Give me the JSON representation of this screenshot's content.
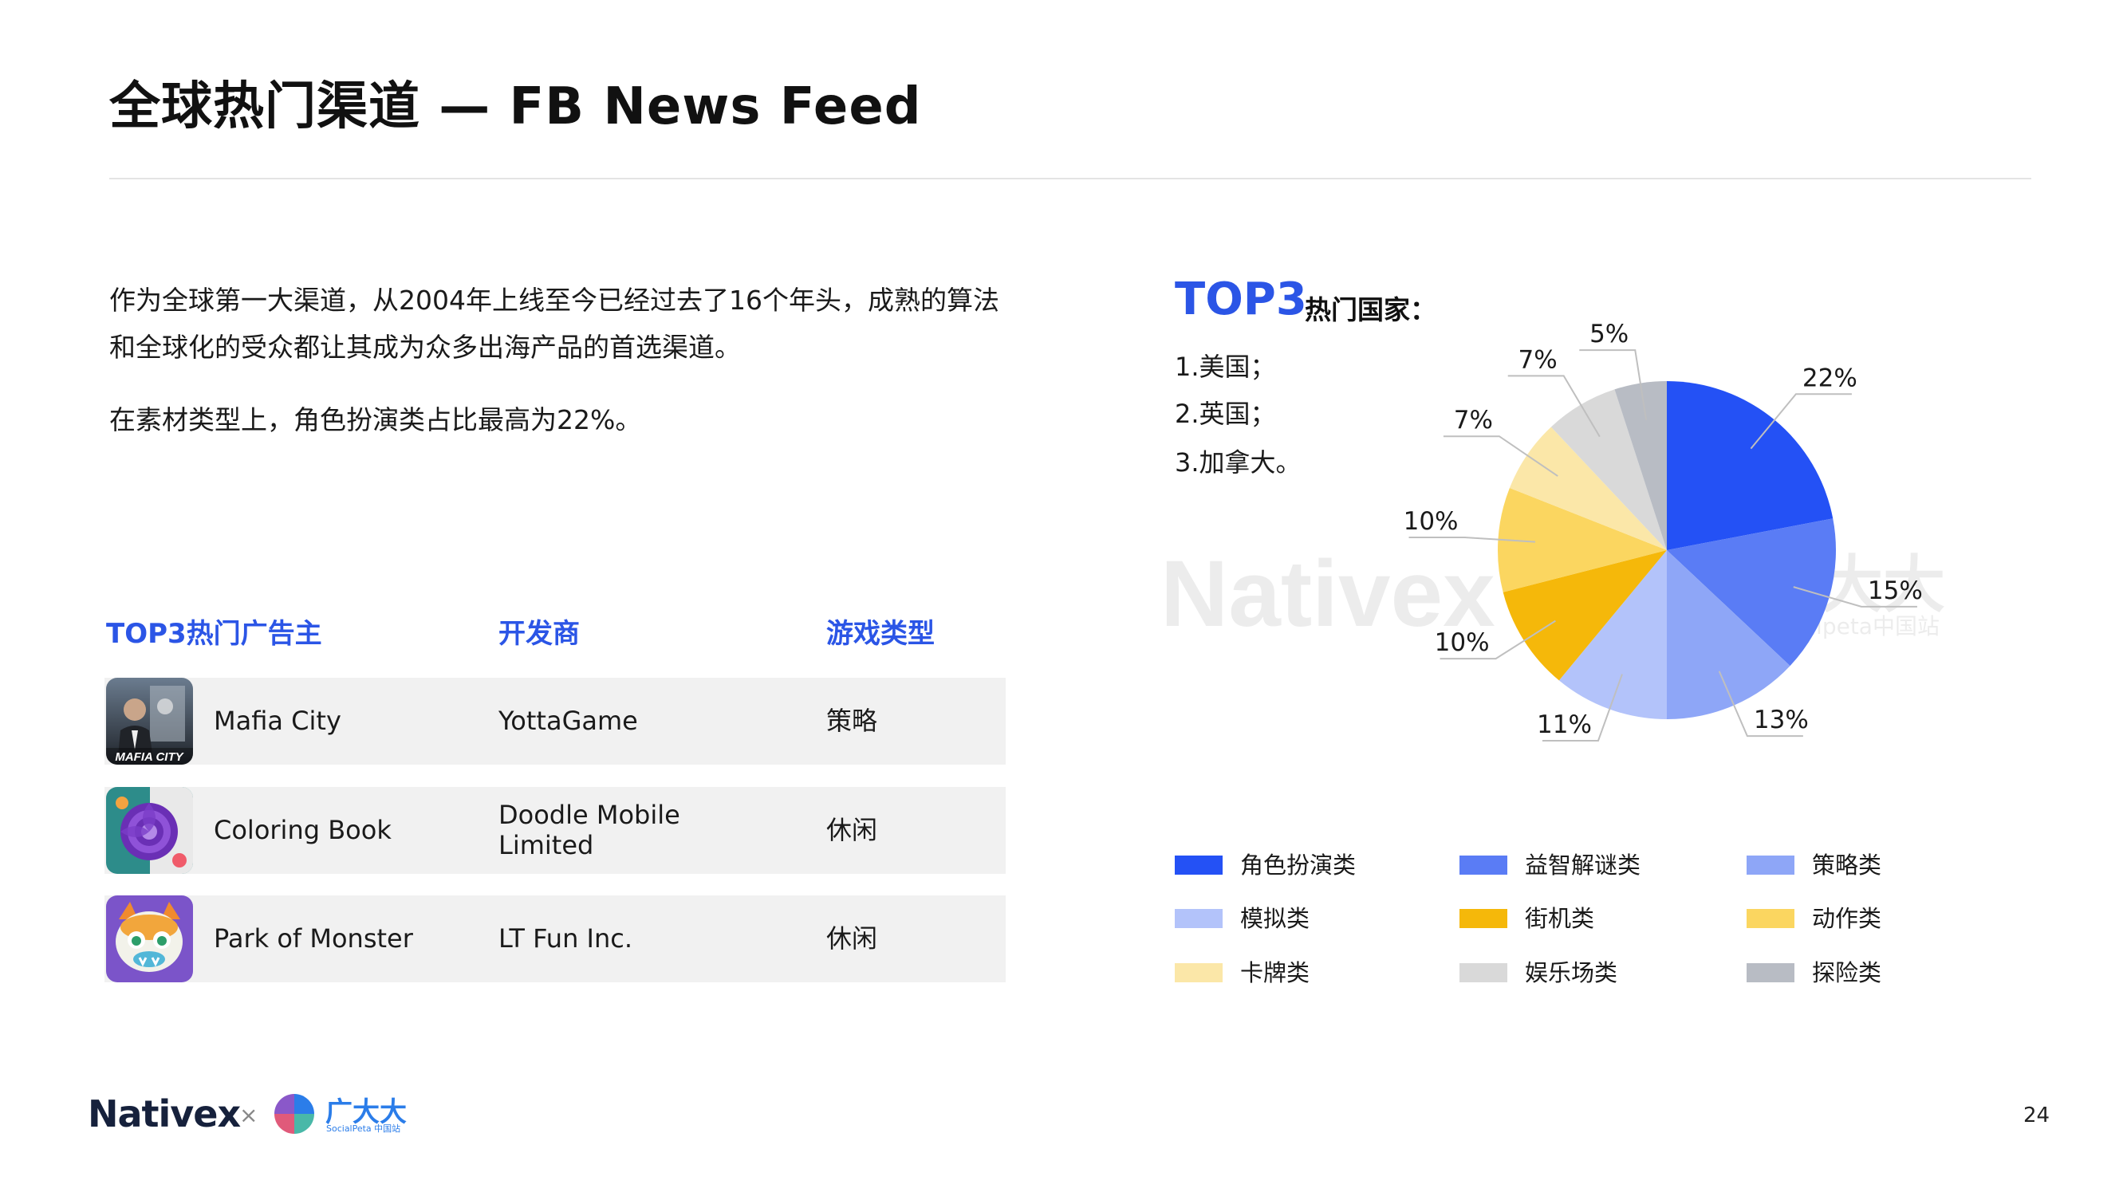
{
  "title": "全球热门渠道 — FB News Feed",
  "intro": {
    "line1": "作为全球第一大渠道，从2004年上线至今已经过去了16个年头，成熟的算法",
    "line2": "和全球化的受众都让其成为众多出海产品的首选渠道。",
    "line3": "在素材类型上，角色扮演类占比最高为22%。"
  },
  "table": {
    "headers": [
      "TOP3热门广告主",
      "开发商",
      "游戏类型"
    ],
    "rows": [
      {
        "app": "Mafia City",
        "icon": "mafia-city-icon",
        "developer_line1": "YottaGame",
        "developer_line2": "",
        "genre": "策略"
      },
      {
        "app": "Coloring Book",
        "icon": "coloring-book-icon",
        "developer_line1": "Doodle Mobile",
        "developer_line2": "Limited",
        "genre": "休闲"
      },
      {
        "app": "Park of Monster",
        "icon": "park-of-monster-icon",
        "developer_line1": "LT Fun Inc.",
        "developer_line2": "",
        "genre": "休闲"
      }
    ]
  },
  "top3": {
    "big": "TOP3",
    "sub": "热门国家：",
    "countries": [
      "1.美国；",
      "2.英国；",
      "3.加拿大。"
    ]
  },
  "watermark": {
    "left": "Nativex",
    "x": "×",
    "right": "广大大",
    "right_sub": "socialpeta中国站"
  },
  "chart_data": {
    "type": "pie",
    "start": "12 o'clock, clockwise",
    "slices": [
      {
        "label": "角色扮演类",
        "value": 22,
        "color": "#2451f5"
      },
      {
        "label": "益智解谜类",
        "value": 15,
        "color": "#5a7cf5"
      },
      {
        "label": "策略类",
        "value": 13,
        "color": "#8ea6f7"
      },
      {
        "label": "模拟类",
        "value": 11,
        "color": "#b3c3fa"
      },
      {
        "label": "街机类",
        "value": 10,
        "color": "#f5b80a"
      },
      {
        "label": "动作类",
        "value": 10,
        "color": "#fbd660"
      },
      {
        "label": "卡牌类",
        "value": 7,
        "color": "#fbe7a8"
      },
      {
        "label": "娱乐场类",
        "value": 7,
        "color": "#d9d9d9"
      },
      {
        "label": "探险类",
        "value": 5,
        "color": "#b8bcc4"
      }
    ],
    "data_labels": [
      "22%",
      "15%",
      "13%",
      "11%",
      "10%",
      "10%",
      "7%",
      "7%",
      "5%"
    ],
    "legend_placement": "bottom"
  },
  "footer": {
    "nativex": "Nativex",
    "x": "×",
    "gdd": "广大大",
    "gdd_sub": "SocialPeta 中国站",
    "page": "24"
  }
}
